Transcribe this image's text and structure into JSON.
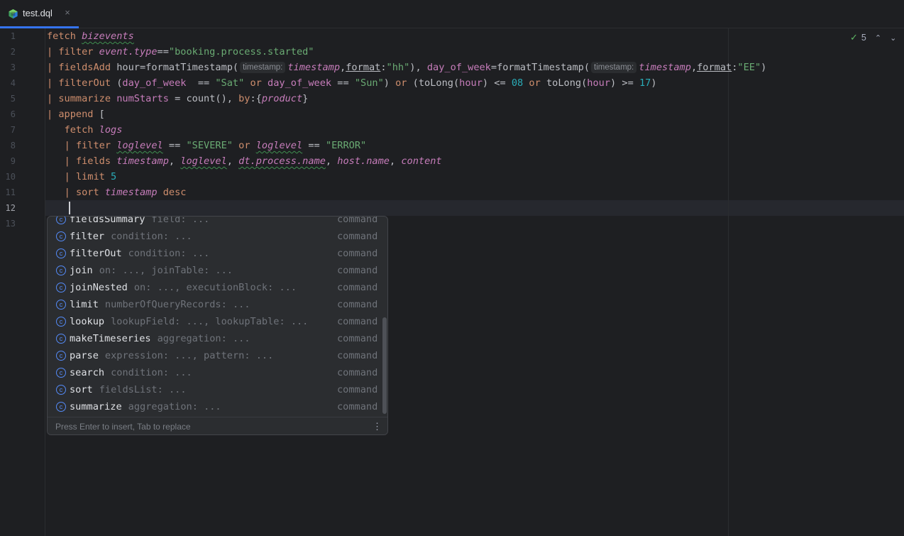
{
  "tab": {
    "label": "test.dql",
    "close_glyph": "×",
    "icon": "dql-file-icon"
  },
  "inspection": {
    "count": "5",
    "check_glyph": "✓",
    "up_glyph": "⌃",
    "down_glyph": "⌄"
  },
  "gutter": {
    "line_numbers": [
      "1",
      "2",
      "3",
      "4",
      "5",
      "6",
      "7",
      "8",
      "9",
      "10",
      "11",
      "12",
      "13"
    ],
    "active_line": "12"
  },
  "code": {
    "l1": {
      "kw": "fetch",
      "src": "bizevents"
    },
    "l2": {
      "pipe": "|",
      "kw": "filter",
      "field": "event.type",
      "op": "==",
      "str": "\"booking.process.started\""
    },
    "l3": {
      "pipe": "|",
      "kw": "fieldsAdd",
      "f1": "hour",
      "eq1": "=",
      "fn1": "formatTimestamp(",
      "hint1": "timestamp:",
      "arg1": "timestamp",
      "comma1": ",",
      "p1": "format",
      "colon1": ":",
      "s1": "\"hh\"",
      "close1": "), ",
      "f2": "day_of_week",
      "eq2": "=",
      "fn2": "formatTimestamp(",
      "hint2": "timestamp:",
      "arg2": "timestamp",
      "comma2": ",",
      "p2": "format",
      "colon2": ":",
      "s2": "\"EE\"",
      "close2": ")"
    },
    "l4": {
      "pipe": "|",
      "kw": "filterOut",
      "t1": " (",
      "f1": "day_of_week",
      "t2": "  == ",
      "s1": "\"Sat\"",
      "or1": " or ",
      "f2": "day_of_week",
      "t3": " == ",
      "s2": "\"Sun\"",
      "t4": ") ",
      "or2": "or",
      "t5": " (toLong(",
      "f3": "hour",
      "t6": ") <= ",
      "n1": "08",
      "or3": " or ",
      "t7": "toLong(",
      "f4": "hour",
      "t8": ") >= ",
      "n2": "17",
      "t9": ")"
    },
    "l5": {
      "pipe": "|",
      "kw": "summarize",
      "f1": "numStarts",
      "t1": " = count(), ",
      "kw2": "by",
      "t2": ":{",
      "f2": "product",
      "t3": "}"
    },
    "l6": {
      "pipe": "|",
      "kw": "append",
      "t1": " ["
    },
    "l7": {
      "kw": "fetch",
      "src": "logs"
    },
    "l8": {
      "pipe": "|",
      "kw": "filter",
      "f1": "loglevel",
      "t1": " == ",
      "s1": "\"SEVERE\"",
      "or1": " or ",
      "f2": "loglevel",
      "t2": " == ",
      "s2": "\"ERROR\""
    },
    "l9": {
      "pipe": "|",
      "kw": "fields",
      "f1": "timestamp",
      "c1": ", ",
      "f2": "loglevel",
      "c2": ", ",
      "f3": "dt.process.name",
      "c3": ", ",
      "f4": "host.name",
      "c4": ", ",
      "f5": "content"
    },
    "l10": {
      "pipe": "|",
      "kw": "limit",
      "n1": "5"
    },
    "l11": {
      "pipe": "|",
      "kw": "sort",
      "f1": "timestamp",
      "kw2": "desc"
    }
  },
  "completion": {
    "items": [
      {
        "name": "fieldsSummary",
        "sig": "field: ...",
        "type": "command"
      },
      {
        "name": "filter",
        "sig": "condition: ...",
        "type": "command"
      },
      {
        "name": "filterOut",
        "sig": "condition: ...",
        "type": "command"
      },
      {
        "name": "join",
        "sig": "on: ..., joinTable: ...",
        "type": "command"
      },
      {
        "name": "joinNested",
        "sig": "on: ..., executionBlock: ...",
        "type": "command"
      },
      {
        "name": "limit",
        "sig": "numberOfQueryRecords: ...",
        "type": "command"
      },
      {
        "name": "lookup",
        "sig": "lookupField: ..., lookupTable: ...",
        "type": "command"
      },
      {
        "name": "makeTimeseries",
        "sig": "aggregation: ...",
        "type": "command"
      },
      {
        "name": "parse",
        "sig": "expression: ..., pattern: ...",
        "type": "command"
      },
      {
        "name": "search",
        "sig": "condition: ...",
        "type": "command"
      },
      {
        "name": "sort",
        "sig": "fieldsList: ...",
        "type": "command"
      },
      {
        "name": "summarize",
        "sig": "aggregation: ...",
        "type": "command"
      }
    ],
    "icon_letter": "c",
    "footer": "Press Enter to insert, Tab to replace",
    "menu_glyph": "⋮"
  },
  "colors": {
    "accent": "#3574f0",
    "keyword": "#cf8e6d",
    "field": "#c77dbb",
    "string": "#6aab73",
    "number": "#2aacb8"
  }
}
